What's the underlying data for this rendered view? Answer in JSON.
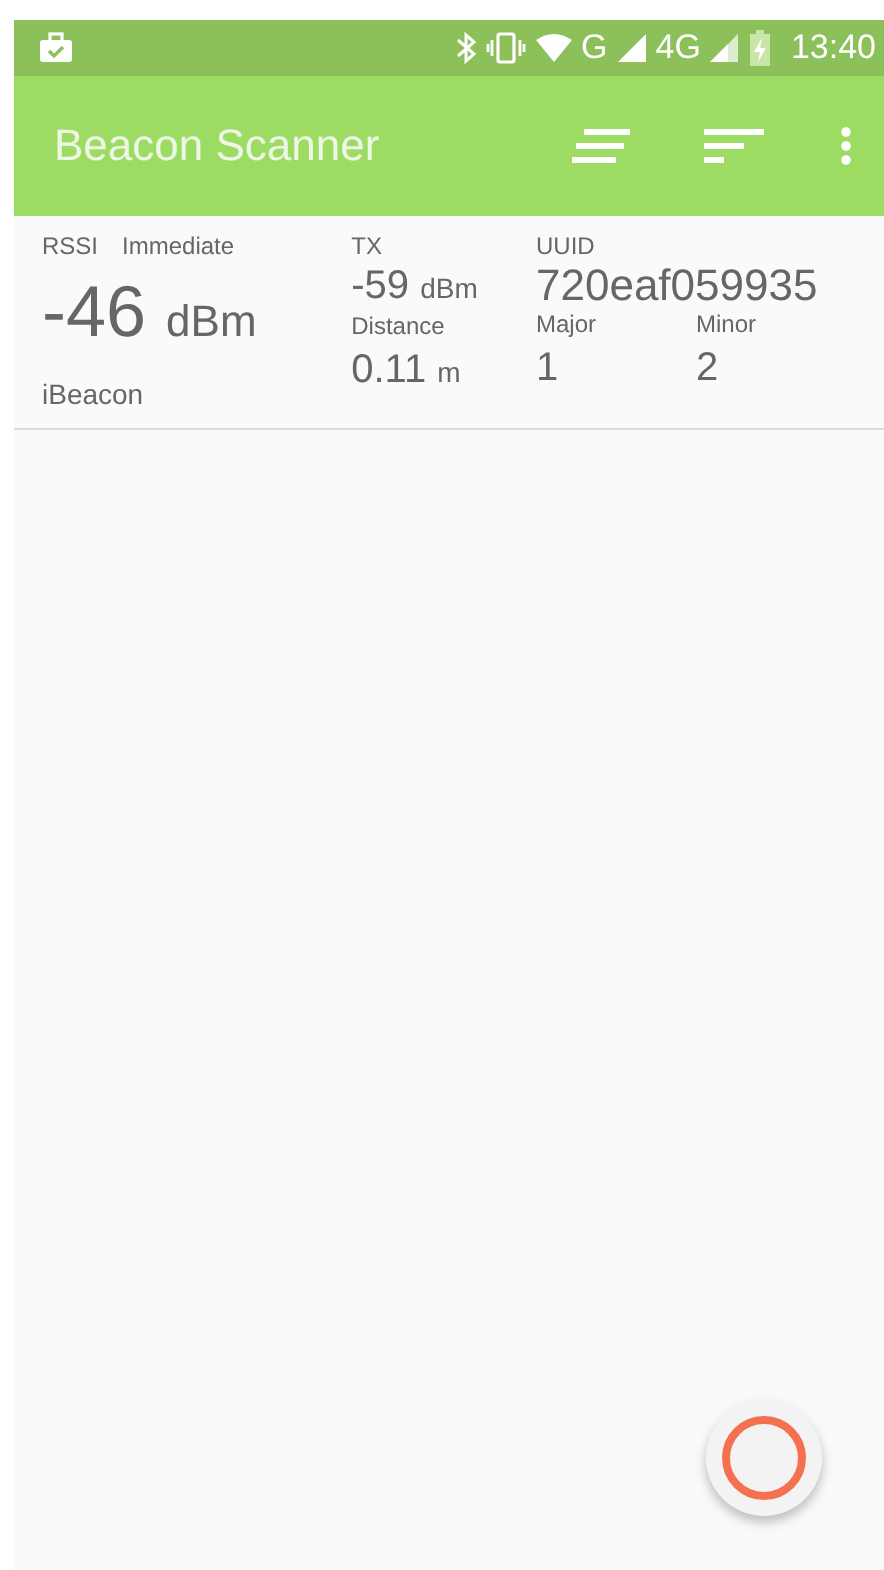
{
  "status_bar": {
    "network_1": "G",
    "network_2": "4G",
    "time": "13:40"
  },
  "toolbar": {
    "title": "Beacon Scanner"
  },
  "beacons": [
    {
      "rssi_label": "RSSI",
      "proximity": "Immediate",
      "rssi": "-46",
      "rssi_unit": "dBm",
      "type": "iBeacon",
      "tx_label": "TX",
      "tx": "-59",
      "tx_unit": "dBm",
      "distance_label": "Distance",
      "distance": "0.11",
      "distance_unit": "m",
      "uuid_label": "UUID",
      "uuid": "720eaf059935",
      "major_label": "Major",
      "major": "1",
      "minor_label": "Minor",
      "minor": "2"
    }
  ],
  "fab": {
    "kind": "record"
  }
}
